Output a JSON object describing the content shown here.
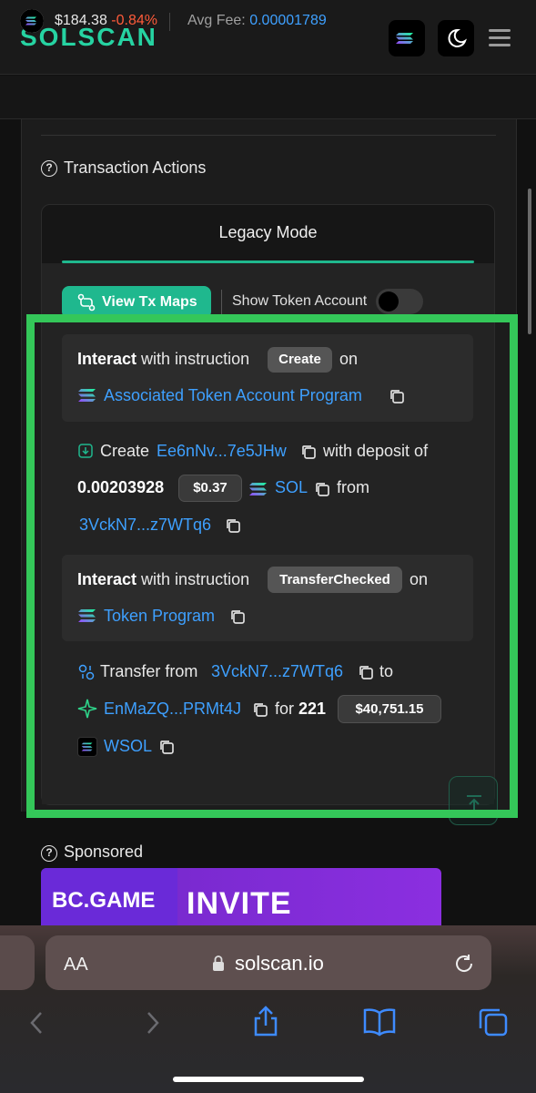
{
  "header": {
    "logo": "SOLSCAN",
    "icons": [
      "solana-icon",
      "moon-icon",
      "menu-icon"
    ]
  },
  "pricebar": {
    "price": "$184.38",
    "change": "-0.84%",
    "avg_fee_label": "Avg Fee:",
    "avg_fee_value": "0.00001789"
  },
  "section": {
    "title": "Transaction Actions",
    "tab": "Legacy Mode",
    "view_maps_label": "View Tx Maps",
    "show_token_label": "Show Token Account",
    "show_token_enabled": false
  },
  "actions": {
    "a1": {
      "interact": "Interact",
      "with": "with instruction",
      "instruction": "Create",
      "on": "on",
      "program": "Associated Token Account Program"
    },
    "a2": {
      "verb": "Create",
      "address": "Ee6nNv...7e5JHw",
      "with_deposit": "with deposit of",
      "amount": "0.00203928",
      "usd": "$0.37",
      "token": "SOL",
      "from": "from",
      "from_address": "3VckN7...z7WTq6"
    },
    "a3": {
      "interact": "Interact",
      "with": "with instruction",
      "instruction": "TransferChecked",
      "on": "on",
      "program": "Token Program"
    },
    "a4": {
      "verb": "Transfer from",
      "from_address": "3VckN7...z7WTq6",
      "to": "to",
      "to_address": "EnMaZQ...PRMt4J",
      "for": "for",
      "amount": "221",
      "usd": "$40,751.15",
      "token": "WSOL"
    }
  },
  "sponsored": {
    "title": "Sponsored",
    "ad_logo": "BC.GAME",
    "ad_text": "INVITE"
  },
  "browser": {
    "aa": "AA",
    "url": "solscan.io"
  },
  "colors": {
    "brand": "#26d3a2",
    "accent": "#1fb88e",
    "link": "#3ea0ff",
    "negative": "#ff5b3a",
    "highlight": "#34c759"
  }
}
